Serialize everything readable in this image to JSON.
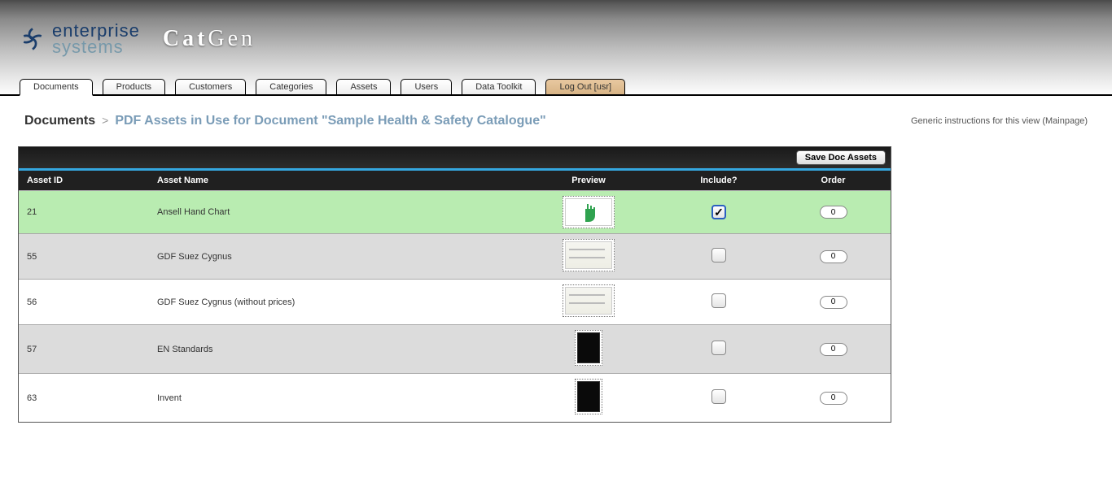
{
  "logo": {
    "top": "enterprise",
    "bottom": "systems"
  },
  "app_title": {
    "cat": "Cat",
    "gen": "Gen"
  },
  "tabs": [
    {
      "label": "Documents",
      "active": true
    },
    {
      "label": "Products"
    },
    {
      "label": "Customers"
    },
    {
      "label": "Categories"
    },
    {
      "label": "Assets"
    },
    {
      "label": "Users"
    },
    {
      "label": "Data Toolkit"
    },
    {
      "label": "Log Out [usr]",
      "logout": true
    }
  ],
  "breadcrumb": {
    "root": "Documents",
    "sep": ">",
    "leaf": "PDF Assets in Use for Document \"Sample Health & Safety Catalogue\""
  },
  "instructions": "Generic instructions for this view (Mainpage)",
  "toolbar": {
    "save_label": "Save Doc Assets"
  },
  "columns": {
    "id": "Asset ID",
    "name": "Asset Name",
    "preview": "Preview",
    "include": "Include?",
    "order": "Order"
  },
  "rows": [
    {
      "id": "21",
      "name": "Ansell Hand Chart",
      "thumb": "hand",
      "included": true,
      "order": "0",
      "tone": "green"
    },
    {
      "id": "55",
      "name": "GDF Suez Cygnus",
      "thumb": "doc",
      "included": false,
      "order": "0",
      "tone": "grey"
    },
    {
      "id": "56",
      "name": "GDF Suez Cygnus (without prices)",
      "thumb": "doc",
      "included": false,
      "order": "0",
      "tone": "white"
    },
    {
      "id": "57",
      "name": "EN Standards",
      "thumb": "dark",
      "included": false,
      "order": "0",
      "tone": "grey"
    },
    {
      "id": "63",
      "name": "Invent",
      "thumb": "dark",
      "included": false,
      "order": "0",
      "tone": "white"
    }
  ]
}
